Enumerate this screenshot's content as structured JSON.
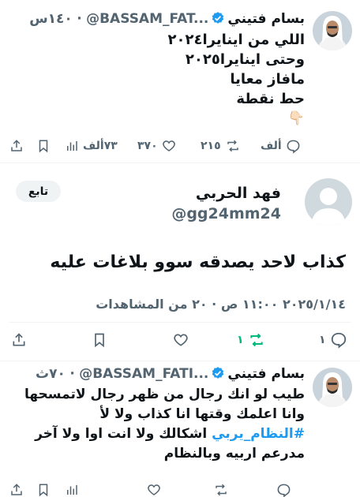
{
  "tweet1": {
    "name": "بسام فتيني",
    "handle": "@BASSAM_FAT...",
    "time": "١٤٠س",
    "lines": [
      "اللي من اينايرا٢٠٢٤",
      "وحتى اينايرا٢٠٢٥",
      "مافاز معايا",
      "حط نقطة",
      "👇🏻"
    ],
    "replies": "ألف",
    "reposts": "٢١٥",
    "likes": "٣٧٠",
    "views": "٧٣ألف"
  },
  "focal": {
    "follow_label": "تابع",
    "name": "فهد الحربي",
    "handle": "@gg24mm24",
    "text": "كذاب لاحد يصدقه سوو بلاغات عليه",
    "meta": "٢٠٢٥/١/١٤ ١١:٠٠ ص · ٢٠ من المشاهدات",
    "replies": "١",
    "reposts": "١"
  },
  "tweet2": {
    "name": "بسام فتيني",
    "handle": "@BASSAM_FATI...",
    "time": "٧٠ث",
    "lines": [
      "طيب لو انك رجال من ظهر رجال لاتمسحها",
      "وانا اعلمك وقتها انا كذاب ولا لأ"
    ],
    "hashtag": "#النظام_يربي",
    "hashtag_rest": "اشكالك ولا انت اوا ولا آخر",
    "last_line": "مدرعم اربيه وبالنظام"
  },
  "colors": {
    "accent": "#1d9bf0",
    "repost_active": "#00ba7c",
    "secondary": "#536471"
  }
}
